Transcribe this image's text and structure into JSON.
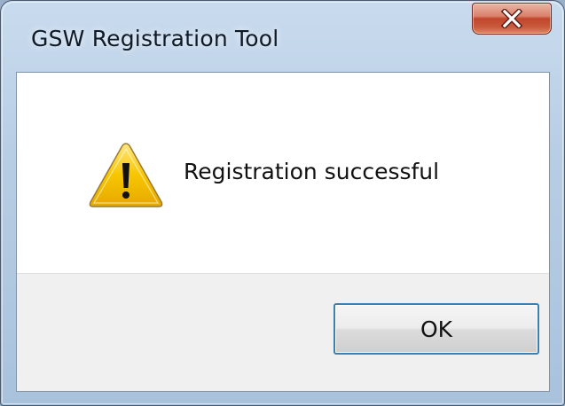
{
  "window": {
    "title": "GSW Registration Tool"
  },
  "title_bar": {
    "close_icon": "close-icon",
    "close_color": "#c2462b"
  },
  "message": {
    "icon": "warning-icon",
    "icon_color": "#f5c400",
    "text": "Registration successful"
  },
  "buttons": {
    "ok_label": "OK",
    "focus_border_color": "#3c7fb1"
  }
}
